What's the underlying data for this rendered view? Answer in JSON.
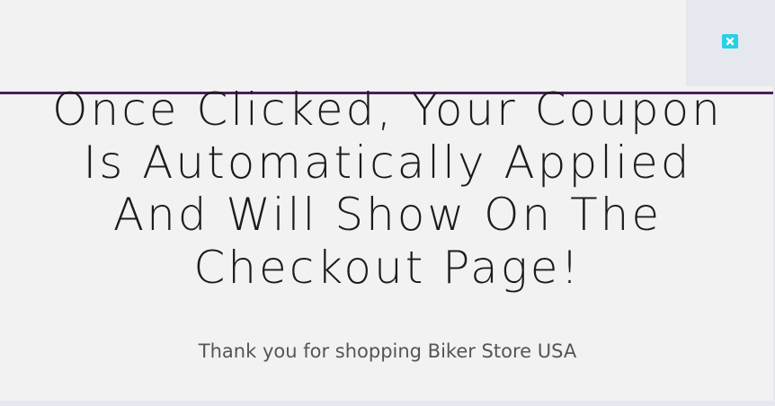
{
  "popup": {
    "headline": "Once Clicked, Your Coupon Is Automatically Applied And Will Show On The Checkout Page!",
    "message": "Thank you for shopping Biker Store USA",
    "close_icon": "close-icon"
  },
  "colors": {
    "background": "#f2f2f2",
    "divider": "#4d1f5e",
    "close_button": "#27d0e6",
    "headline_text": "#1c1c1c",
    "message_text": "#555555"
  }
}
